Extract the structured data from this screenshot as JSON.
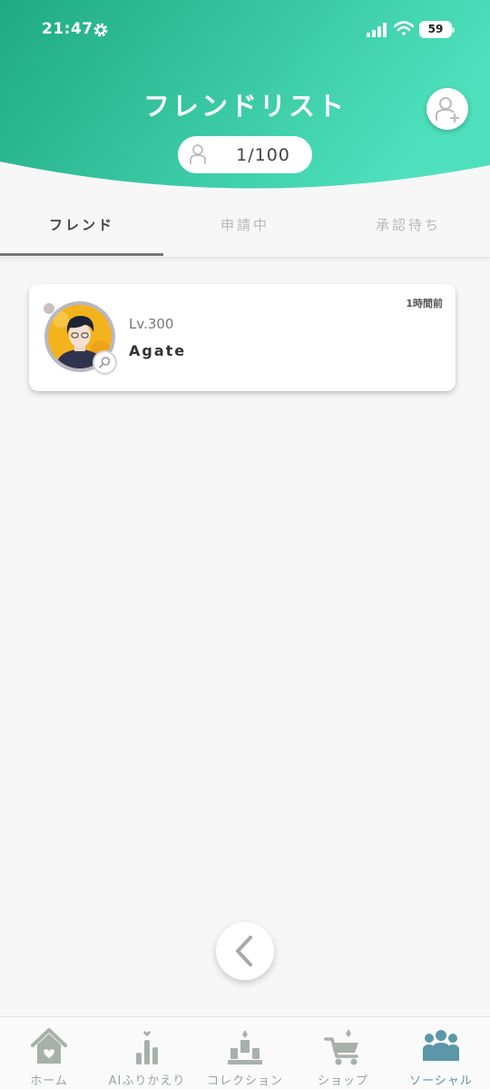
{
  "status_bar": {
    "time": "21:47",
    "battery": "59"
  },
  "header": {
    "title": "フレンドリスト",
    "friend_count": "1/100"
  },
  "tabs": [
    {
      "label": "フレンド",
      "active": true
    },
    {
      "label": "申請中",
      "active": false
    },
    {
      "label": "承認待ち",
      "active": false
    }
  ],
  "friends": [
    {
      "level": "Lv.300",
      "name": "Agate",
      "last_seen": "1時間前",
      "online": false
    }
  ],
  "bottom_nav": [
    {
      "label": "ホーム",
      "icon": "home-icon",
      "active": false
    },
    {
      "label": "AIふりかえり",
      "icon": "ai-review-icon",
      "active": false
    },
    {
      "label": "コレクション",
      "icon": "collection-icon",
      "active": false
    },
    {
      "label": "ショップ",
      "icon": "shop-cart-icon",
      "active": false
    },
    {
      "label": "ソーシャル",
      "icon": "social-icon",
      "active": true
    }
  ],
  "colors": {
    "header_gradient_start": "#1faa82",
    "header_gradient_end": "#4ee0bd",
    "nav_active": "#5b97a8",
    "nav_inactive": "#a7b0a9"
  }
}
